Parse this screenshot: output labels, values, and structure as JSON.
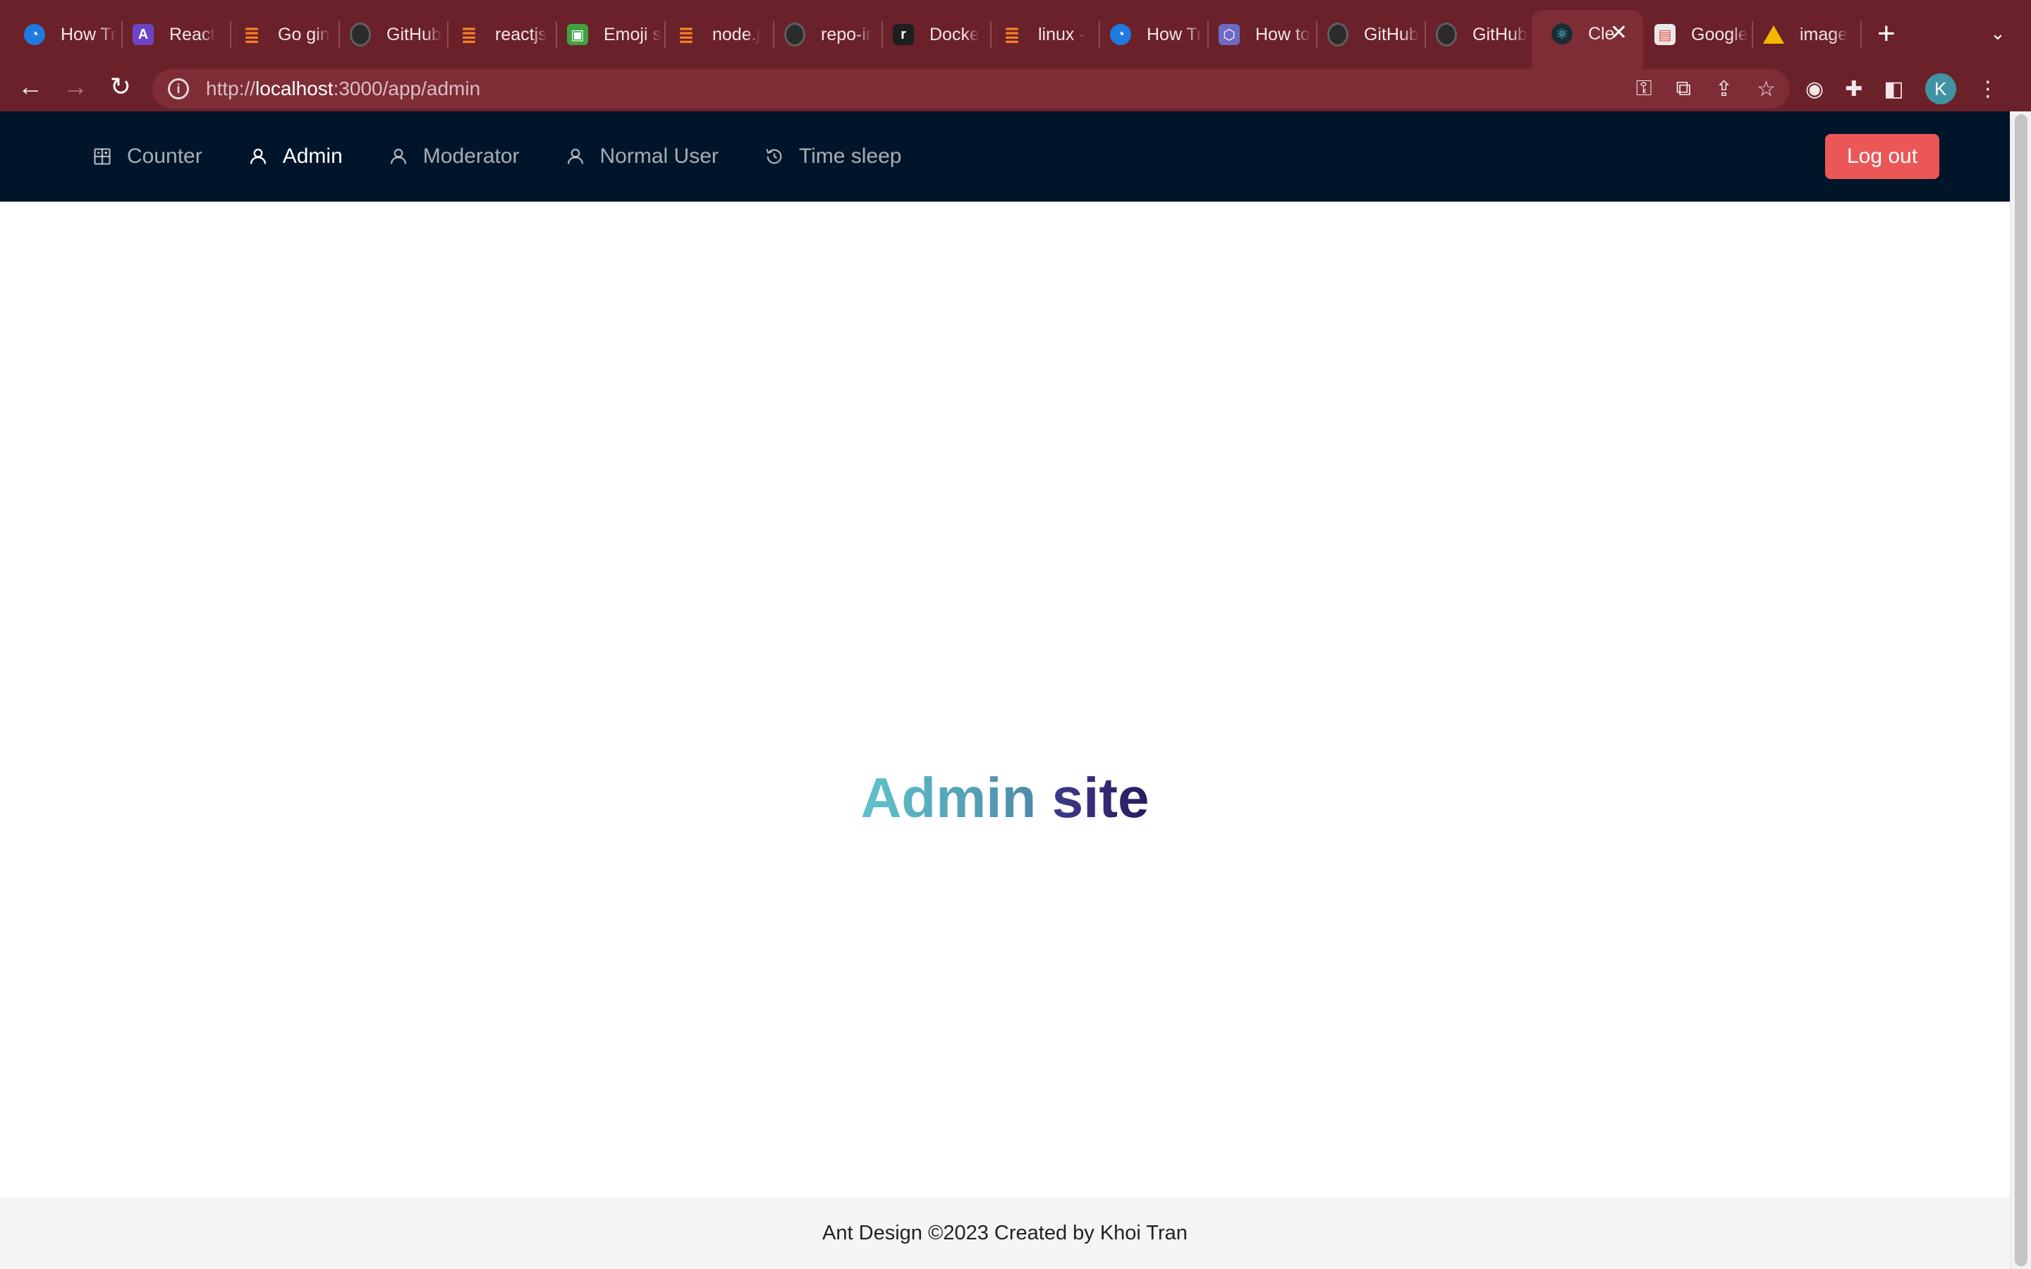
{
  "browser": {
    "tabs": [
      {
        "title": "How Tr",
        "icon": "edge-logo-icon"
      },
      {
        "title": "React",
        "icon": "react-router-icon"
      },
      {
        "title": "Go gin",
        "icon": "stackoverflow-icon"
      },
      {
        "title": "GitHub",
        "icon": "github-icon"
      },
      {
        "title": "reactjs",
        "icon": "stackoverflow-icon"
      },
      {
        "title": "Emoji s",
        "icon": "emoji-site-icon"
      },
      {
        "title": "node.j",
        "icon": "stackoverflow-icon"
      },
      {
        "title": "repo-ir",
        "icon": "github-icon"
      },
      {
        "title": "Docke",
        "icon": "render-icon"
      },
      {
        "title": "linux -",
        "icon": "stackoverflow-icon"
      },
      {
        "title": "How Tr",
        "icon": "edge-logo-icon"
      },
      {
        "title": "How to",
        "icon": "hexagon-icon"
      },
      {
        "title": "GitHub",
        "icon": "github-icon"
      },
      {
        "title": "GitHub",
        "icon": "github-icon"
      },
      {
        "title": "Cle",
        "icon": "react-icon",
        "active": true
      },
      {
        "title": "Google",
        "icon": "google-docs-icon"
      },
      {
        "title": "image",
        "icon": "google-drive-icon"
      }
    ],
    "url_prefix": "http://",
    "url_host": "localhost",
    "url_rest": ":3000/app/admin",
    "profile_initial": "K",
    "colors": {
      "frame": "#6b2129",
      "omnibox": "#7e2d36"
    }
  },
  "header": {
    "menu": [
      {
        "label": "Counter",
        "icon": "calculator-icon"
      },
      {
        "label": "Admin",
        "icon": "user-icon",
        "selected": true
      },
      {
        "label": "Moderator",
        "icon": "user-icon"
      },
      {
        "label": "Normal User",
        "icon": "user-icon"
      },
      {
        "label": "Time sleep",
        "icon": "clock-history-icon"
      }
    ],
    "logout_label": "Log out",
    "colors": {
      "background": "#001529",
      "logout": "#eb5757"
    }
  },
  "main": {
    "headline_word1": "Admin",
    "headline_word2": "site"
  },
  "footer": {
    "text": "Ant Design ©2023 Created by Khoi Tran"
  }
}
